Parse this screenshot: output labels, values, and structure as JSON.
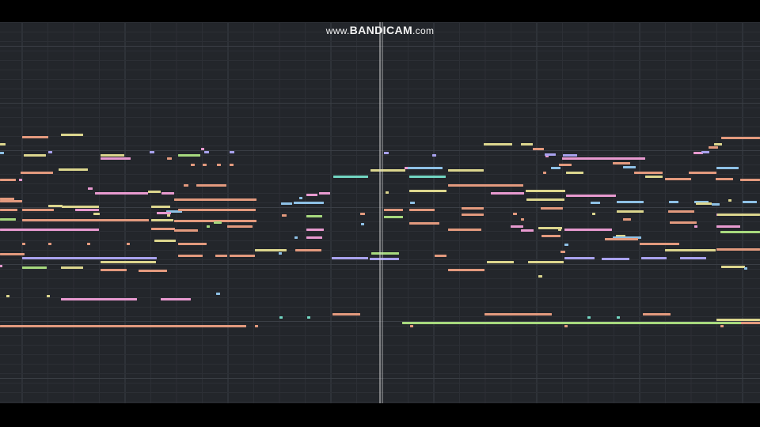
{
  "watermark": {
    "prefix": "www.",
    "brand": "BANDICAM",
    "suffix": ".com"
  },
  "colors": {
    "background": "#23262b",
    "grid_minor": "#2c2f35",
    "grid_major": "#3a3e45",
    "playhead": "#d8d8d8",
    "note_orange": "#e39a7e",
    "note_yellow": "#dcd68e",
    "note_green": "#a7d97e",
    "note_pink": "#e89ad0",
    "note_blue": "#8ec1e6",
    "note_teal": "#72d6c2",
    "note_purple": "#a9a2ee",
    "note_peach": "#e8b58a"
  }
}
